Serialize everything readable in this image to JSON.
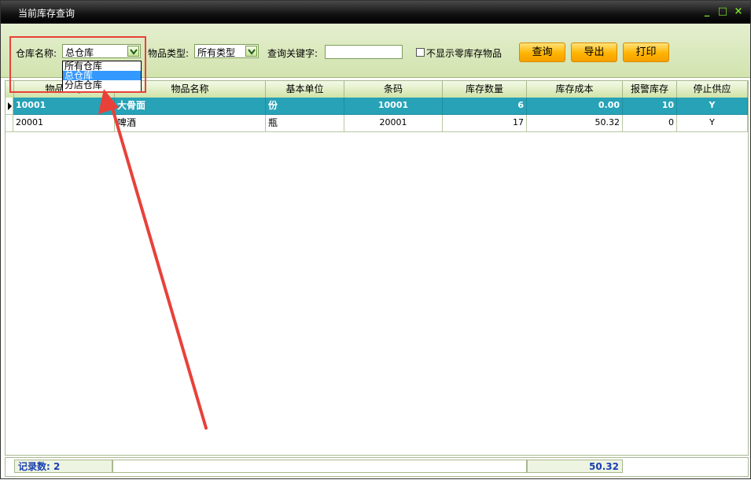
{
  "window": {
    "title": "当前库存查询",
    "controls": [
      "_",
      "□",
      "×"
    ]
  },
  "toolbar": {
    "warehouse_label": "仓库名称:",
    "warehouse_value": "总仓库",
    "warehouse_options": [
      "所有仓库",
      "总仓库",
      "分店仓库"
    ],
    "category_label": "物品类型:",
    "category_value": "所有类型",
    "keyword_label": "查询关键字:",
    "keyword_value": "",
    "hide_zero_label": "不显示零库存物品",
    "query_btn": "查询",
    "export_btn": "导出",
    "print_btn": "打印"
  },
  "table": {
    "columns": [
      "物品编号",
      "物品名称",
      "基本单位",
      "条码",
      "库存数量",
      "库存成本",
      "报警库存",
      "停止供应"
    ],
    "rows": [
      [
        "10001",
        "大骨面",
        "份",
        "10001",
        "6",
        "0.00",
        "10",
        "Y"
      ],
      [
        "20001",
        "啤酒",
        "瓶",
        "20001",
        "17",
        "50.32",
        "0",
        "Y"
      ]
    ]
  },
  "status": {
    "record_count": "记录数: 2",
    "total_cost": "50.32"
  },
  "colors": {
    "selected_row": "#27a2b7",
    "button": "#ffb400",
    "annotation": "#e8413a"
  }
}
